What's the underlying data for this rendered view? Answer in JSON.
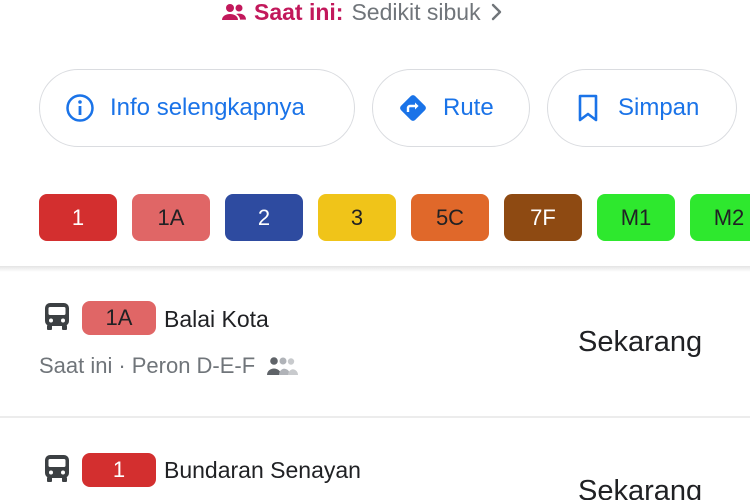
{
  "status": {
    "prefix": "Saat ini:",
    "level": "Sedikit sibuk"
  },
  "actions": [
    {
      "label": "Info selengkapnya",
      "icon": "info-icon"
    },
    {
      "label": "Rute",
      "icon": "directions-icon"
    },
    {
      "label": "Simpan",
      "icon": "bookmark-icon"
    }
  ],
  "routes": [
    {
      "label": "1",
      "bg": "#d32f2f",
      "fg": "#ffffff"
    },
    {
      "label": "1A",
      "bg": "#e06666",
      "fg": "#202124"
    },
    {
      "label": "2",
      "bg": "#2e4ba0",
      "fg": "#ffffff"
    },
    {
      "label": "3",
      "bg": "#f0c419",
      "fg": "#202124"
    },
    {
      "label": "5C",
      "bg": "#e0682a",
      "fg": "#202124"
    },
    {
      "label": "7F",
      "bg": "#8e4a12",
      "fg": "#ffffff"
    },
    {
      "label": "M1",
      "bg": "#2ee82e",
      "fg": "#202124"
    },
    {
      "label": "M2",
      "bg": "#2ee82e",
      "fg": "#202124"
    }
  ],
  "departures": [
    {
      "route": "1A",
      "route_bg": "#e06666",
      "route_fg": "#202124",
      "destination": "Balai Kota",
      "status": "Saat ini",
      "separator": "·",
      "platform": "Peron D-E-F",
      "time": "Sekarang"
    },
    {
      "route": "1",
      "route_bg": "#d32f2f",
      "route_fg": "#ffffff",
      "destination": "Bundaran Senayan",
      "time": "Sekarang"
    }
  ],
  "colors": {
    "accent": "#1a73e8",
    "busy": "#c2185b",
    "muted": "#70757a"
  }
}
